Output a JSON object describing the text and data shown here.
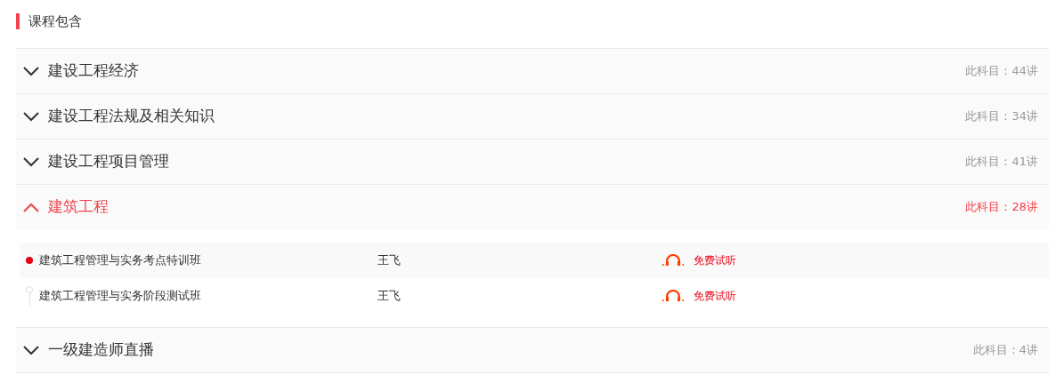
{
  "title": "课程包含",
  "subjects": [
    {
      "name": "建设工程经济",
      "count": "此科目：44讲",
      "expanded": false
    },
    {
      "name": "建设工程法规及相关知识",
      "count": "此科目：34讲",
      "expanded": false
    },
    {
      "name": "建设工程项目管理",
      "count": "此科目：41讲",
      "expanded": false
    },
    {
      "name": "建筑工程",
      "count": "此科目：28讲",
      "expanded": true,
      "lessons": [
        {
          "title": "建筑工程管理与实务考点特训班",
          "teacher": "王飞",
          "action": "免费试听",
          "selected": true
        },
        {
          "title": "建筑工程管理与实务阶段测试班",
          "teacher": "王飞",
          "action": "免费试听",
          "selected": false
        }
      ]
    },
    {
      "name": "一级建造师直播",
      "count": "此科目：4讲",
      "expanded": false
    }
  ]
}
